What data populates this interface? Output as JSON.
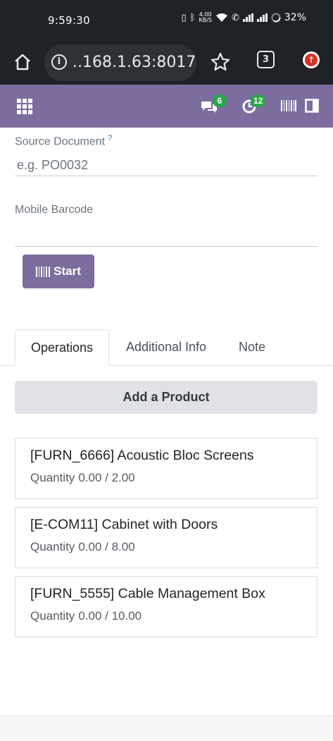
{
  "status_bar": {
    "time": "9:59:30",
    "net_speed_value": "4.00",
    "net_speed_unit": "KB/S",
    "battery": "32%"
  },
  "browser": {
    "url": "..168.1.63:8017",
    "tab_count": "3"
  },
  "navbar": {
    "messages_badge": "6",
    "activities_badge": "12"
  },
  "form": {
    "source_document": {
      "label": "Source Document",
      "help": "?",
      "placeholder": "e.g. PO0032"
    },
    "mobile_barcode": {
      "label": "Mobile Barcode",
      "value": ""
    },
    "start_button": "Start"
  },
  "tabs": [
    {
      "label": "Operations",
      "active": true
    },
    {
      "label": "Additional Info",
      "active": false
    },
    {
      "label": "Note",
      "active": false
    }
  ],
  "operations": {
    "add_product": "Add a Product",
    "quantity_label": "Quantity",
    "products": [
      {
        "name": "[FURN_6666] Acoustic Bloc Screens",
        "quantity": "0.00 / 2.00"
      },
      {
        "name": "[E-COM11] Cabinet with Doors",
        "quantity": "0.00 / 8.00"
      },
      {
        "name": "[FURN_5555] Cable Management Box",
        "quantity": "0.00 / 10.00"
      }
    ]
  },
  "colors": {
    "brand": "#7c6d9e",
    "badge": "#28a745",
    "browser_chrome": "#1f2226"
  }
}
